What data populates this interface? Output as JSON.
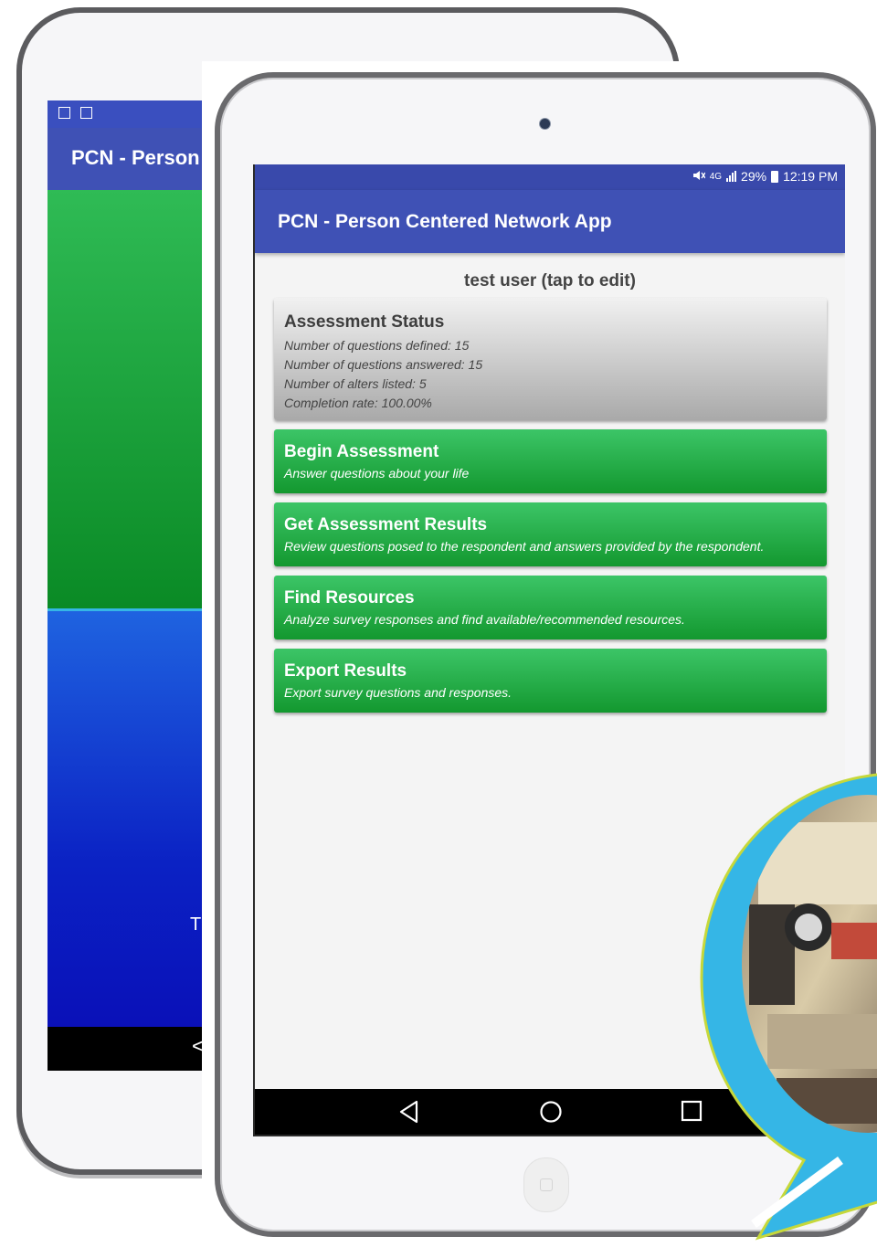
{
  "back_tablet": {
    "app_title": "PCN - Person C",
    "partial_text": "T",
    "nav_glyph": "<"
  },
  "front_tablet": {
    "status_bar": {
      "network": "4G",
      "battery_percent": "29%",
      "time": "12:19 PM"
    },
    "app_bar": {
      "title": "PCN - Person Centered Network App"
    },
    "user_line": "test user (tap to edit)",
    "assessment_status": {
      "title": "Assessment Status",
      "lines": [
        "Number of questions defined:  15",
        "Number of questions answered:  15",
        "Number of alters listed:  5",
        "Completion rate:  100.00%"
      ]
    },
    "actions": [
      {
        "title": "Begin Assessment",
        "subtitle": "Answer questions about your life"
      },
      {
        "title": "Get Assessment Results",
        "subtitle": "Review questions posed to the respondent and answers provided by the respondent."
      },
      {
        "title": "Find Resources",
        "subtitle": "Analyze survey responses and find available/recommended resources."
      },
      {
        "title": "Export Results",
        "subtitle": "Export survey questions and responses."
      }
    ]
  },
  "colors": {
    "primary": "#3f51b5",
    "status_bar": "#3949ab",
    "action_green": "#1ea13f",
    "bubble": "#35b6e6",
    "bubble_border": "#c6d83a"
  }
}
